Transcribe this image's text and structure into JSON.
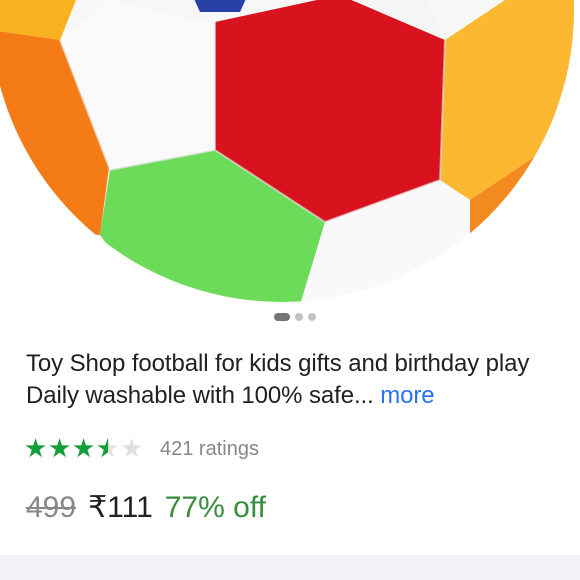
{
  "product": {
    "title": "Toy Shop football for kids gifts and birthday play Daily washable with 100% safe...",
    "more_label": "more",
    "image_alt": "football-toy-image"
  },
  "carousel": {
    "count": 3,
    "active_index": 0
  },
  "rating": {
    "stars": 3.5,
    "max_stars": 5,
    "count_text": "421 ratings",
    "star_color": "#139e3a"
  },
  "price": {
    "mrp": "499",
    "current": "₹111",
    "discount": "77% off",
    "discount_color": "#388e3c"
  }
}
